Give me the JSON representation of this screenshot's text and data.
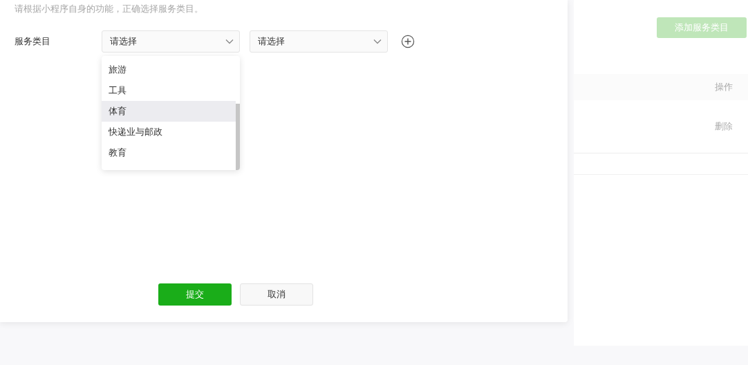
{
  "background_page": {
    "add_button": "添加服务类目",
    "table": {
      "columns": [
        "操作"
      ],
      "rows": [
        [
          "删除"
        ]
      ]
    }
  },
  "dialog": {
    "hint": "请根据小程序自身的功能，正确选择服务类目。",
    "field_label": "服务类目",
    "selects": [
      {
        "value": "请选择"
      },
      {
        "value": "请选择"
      }
    ],
    "dropdown": {
      "options": [
        {
          "label": "旅游",
          "selected": false
        },
        {
          "label": "工具",
          "selected": false
        },
        {
          "label": "体育",
          "selected": true
        },
        {
          "label": "快递业与邮政",
          "selected": false
        },
        {
          "label": "教育",
          "selected": false
        }
      ]
    },
    "buttons": [
      {
        "label": "提交",
        "kind": "primary"
      },
      {
        "label": "取消",
        "kind": "default"
      }
    ]
  }
}
